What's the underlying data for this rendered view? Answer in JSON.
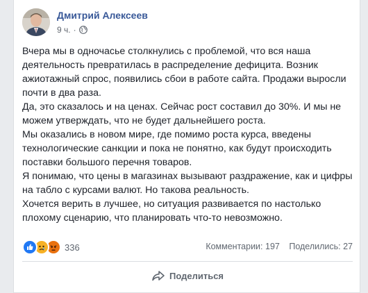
{
  "post": {
    "author": "Дмитрий Алексеев",
    "time": "9 ч.",
    "separator": "·",
    "privacy_icon": "globe-icon",
    "paragraphs": [
      "Вчера мы в одночасье столкнулись с проблемой, что вся наша деятельность превратилась в распределение дефицита. Возник ажиотажный спрос, появились сбои в работе сайта. Продажи выросли почти в два раза.",
      "Да, это сказалось и на ценах. Сейчас рост составил до 30%. И мы не можем утверждать, что не будет дальнейшего роста.",
      "Мы оказались в новом мире, где помимо роста курса, введены технологические санкции и пока не понятно, как будут происходить поставки большого перечня товаров.",
      "Я понимаю, что цены в магазинах вызывают раздражение, как и цифры на табло с курсами валют. Но такова реальность.",
      "Хочется верить в лучшее, но ситуация развивается по настолько плохому сценарию, что планировать что-то невозможно."
    ]
  },
  "stats": {
    "reaction_icons": [
      "like-reaction-icon",
      "sad-reaction-icon",
      "angry-reaction-icon"
    ],
    "reaction_count": "336",
    "comments": "Комментарии: 197",
    "shares": "Поделились: 27"
  },
  "actions": {
    "share_label": "Поделиться",
    "share_icon": "share-arrow-icon"
  },
  "colors": {
    "author_link": "#385898",
    "text": "#1d2129",
    "meta": "#606770",
    "background": "#e9ebee",
    "like": "#2078f4",
    "sad": "#f7b125",
    "angry": "#e9710f"
  }
}
